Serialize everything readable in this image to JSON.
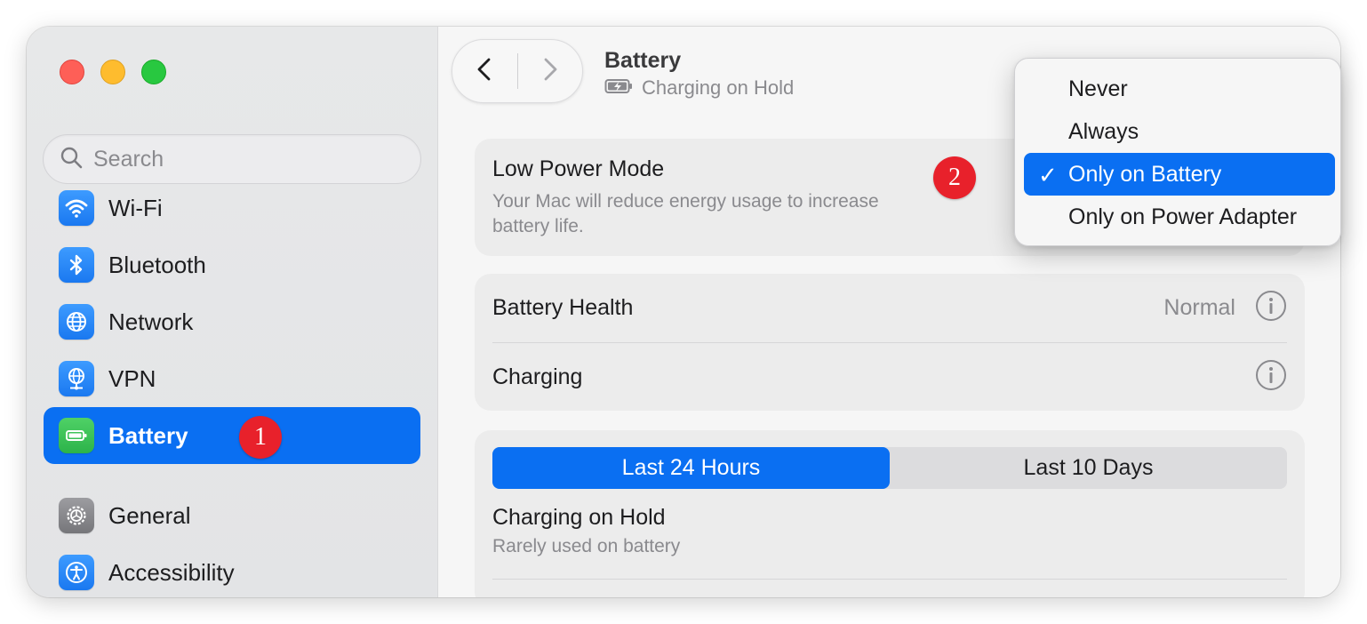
{
  "window": {
    "traffic_lights": [
      "close",
      "minimize",
      "zoom"
    ]
  },
  "sidebar": {
    "search_placeholder": "Search",
    "items": [
      {
        "label": "Wi-Fi",
        "icon": "wifi-icon"
      },
      {
        "label": "Bluetooth",
        "icon": "bluetooth-icon"
      },
      {
        "label": "Network",
        "icon": "globe-icon"
      },
      {
        "label": "VPN",
        "icon": "vpn-globe-icon"
      },
      {
        "label": "Battery",
        "icon": "battery-icon",
        "selected": true
      },
      {
        "label": "General",
        "icon": "gear-icon"
      },
      {
        "label": "Accessibility",
        "icon": "accessibility-icon"
      }
    ]
  },
  "annotations": {
    "step1": "1",
    "step2": "2"
  },
  "header": {
    "title": "Battery",
    "subtitle": "Charging on Hold"
  },
  "low_power": {
    "title": "Low Power Mode",
    "description": "Your Mac will reduce energy usage to increase battery life."
  },
  "battery_health": {
    "title": "Battery Health",
    "value": "Normal"
  },
  "charging": {
    "title": "Charging"
  },
  "history": {
    "tabs": [
      "Last 24 Hours",
      "Last 10 Days"
    ],
    "active_tab": "Last 24 Hours",
    "status_title": "Charging on Hold",
    "status_desc": "Rarely used on battery"
  },
  "dropdown": {
    "options": [
      "Never",
      "Always",
      "Only on Battery",
      "Only on Power Adapter"
    ],
    "selected": "Only on Battery"
  },
  "colors": {
    "accent": "#0a6ff2",
    "badge": "#e8212b"
  }
}
